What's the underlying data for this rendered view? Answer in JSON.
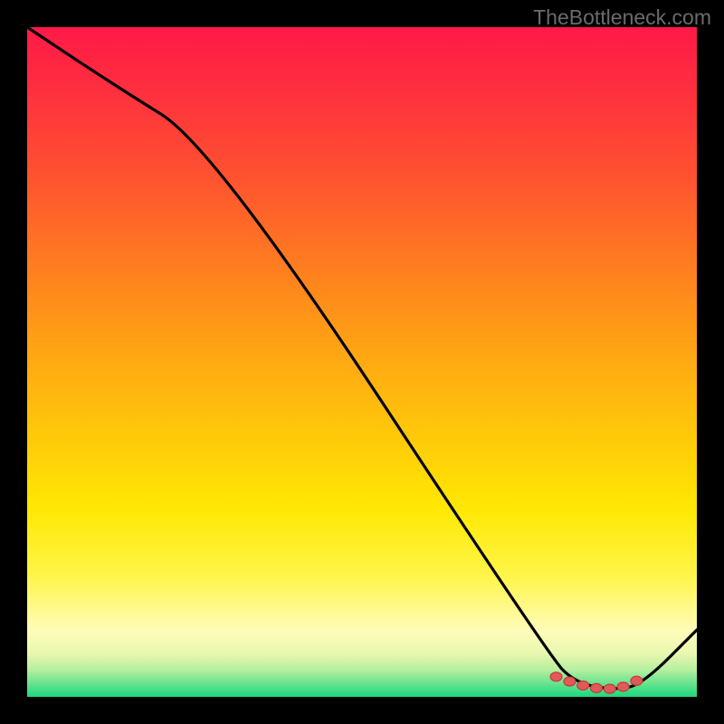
{
  "attribution": "TheBottleneck.com",
  "colors": {
    "page_bg": "#000000",
    "attribution": "#6b6b6b",
    "curve": "#000000",
    "marker_stroke": "#c73a3a",
    "marker_fill": "#e05a5a"
  },
  "chart_data": {
    "type": "line",
    "title": "",
    "xlabel": "",
    "ylabel": "",
    "xlim": [
      0,
      100
    ],
    "ylim": [
      0,
      100
    ],
    "series": [
      {
        "name": "score-curve",
        "x": [
          0,
          12,
          28,
          78,
          82,
          88,
          92,
          100
        ],
        "y": [
          100,
          92,
          82,
          6,
          2,
          1,
          2,
          10
        ]
      }
    ],
    "markers": {
      "name": "highlight-range",
      "x": [
        79,
        81,
        83,
        85,
        87,
        89,
        91
      ],
      "y": [
        3.0,
        2.3,
        1.7,
        1.3,
        1.2,
        1.5,
        2.4
      ]
    }
  }
}
